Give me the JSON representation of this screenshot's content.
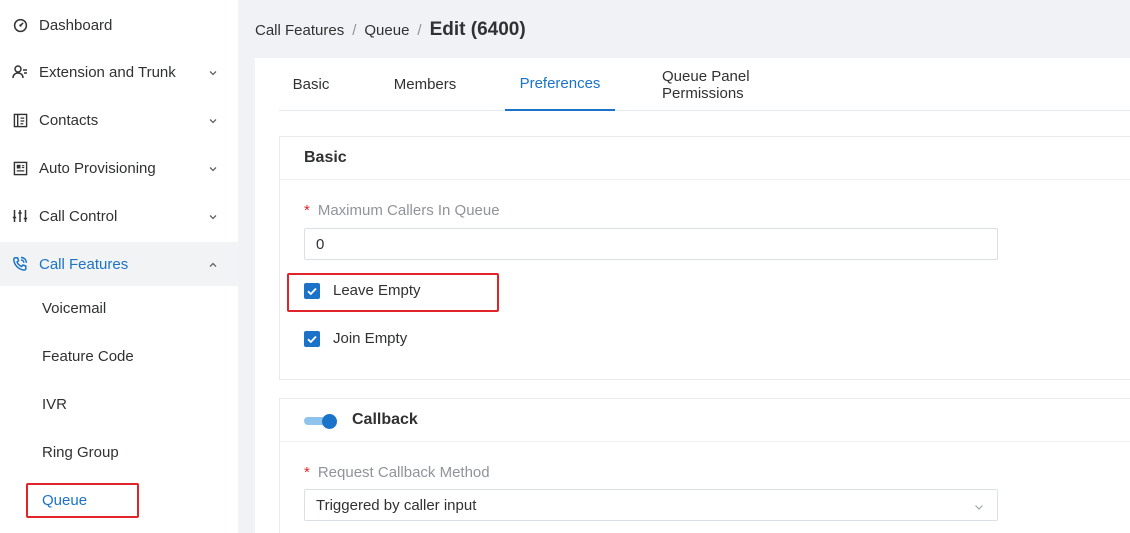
{
  "sidebar": {
    "items": [
      {
        "label": "Dashboard",
        "icon": "dashboard-icon"
      },
      {
        "label": "Extension and Trunk",
        "icon": "user-icon"
      },
      {
        "label": "Contacts",
        "icon": "contacts-icon"
      },
      {
        "label": "Auto Provisioning",
        "icon": "provisioning-icon"
      },
      {
        "label": "Call Control",
        "icon": "sliders-icon"
      },
      {
        "label": "Call Features",
        "icon": "phone-icon"
      }
    ],
    "sub_items": [
      {
        "label": "Voicemail"
      },
      {
        "label": "Feature Code"
      },
      {
        "label": "IVR"
      },
      {
        "label": "Ring Group"
      },
      {
        "label": "Queue"
      }
    ]
  },
  "breadcrumb": {
    "part1": "Call Features",
    "part2": "Queue",
    "current": "Edit (6400)",
    "separator": "/"
  },
  "tabs": [
    "Basic",
    "Members",
    "Preferences",
    "Queue Panel Permissions"
  ],
  "active_tab": "Preferences",
  "basic_section": {
    "title": "Basic",
    "max_callers_label": "Maximum Callers In Queue",
    "max_callers_value": "0",
    "leave_empty_label": "Leave Empty",
    "leave_empty_checked": true,
    "join_empty_label": "Join Empty",
    "join_empty_checked": true
  },
  "callback_section": {
    "title": "Callback",
    "enabled": true,
    "method_label": "Request Callback Method",
    "method_value": "Triggered by caller input"
  },
  "required_marker": "*",
  "colors": {
    "accent": "#1a73c8",
    "highlight_box": "#e0242a"
  }
}
